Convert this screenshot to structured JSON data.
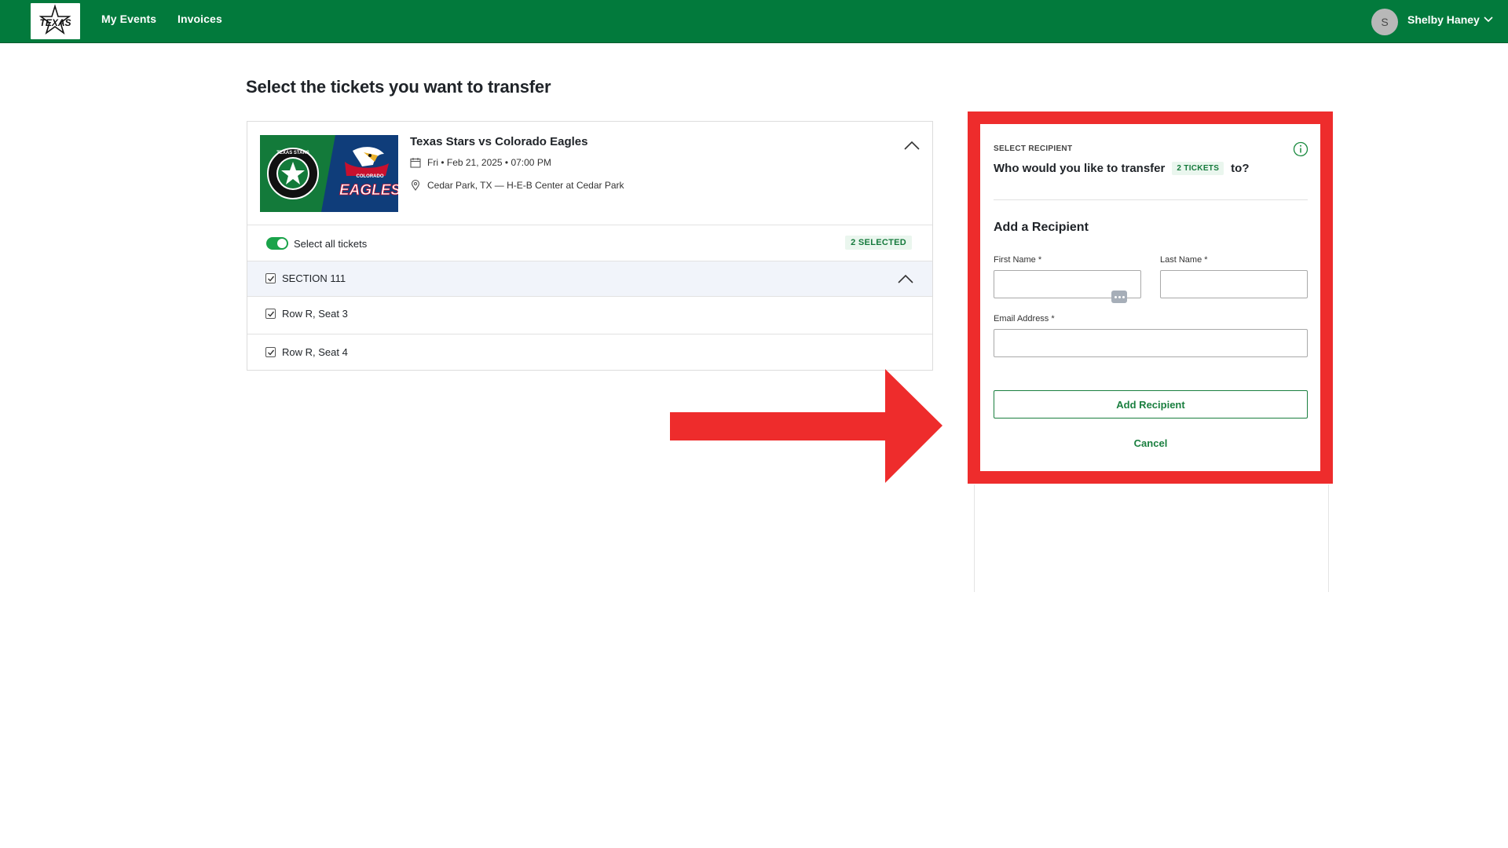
{
  "nav": {
    "logo_text": "TEXAS",
    "links": [
      "My Events",
      "Invoices"
    ],
    "user": {
      "initial": "S",
      "name": "Shelby Haney"
    }
  },
  "page": {
    "title": "Select the tickets you want to transfer"
  },
  "event": {
    "title": "Texas Stars vs Colorado Eagles",
    "datetime": "Fri • Feb 21, 2025 • 07:00 PM",
    "location": "Cedar Park, TX — H-E-B Center at Cedar Park",
    "home_logo_text": "TEXAS STARS",
    "away_logo_text": "EAGLES",
    "away_logo_subtext": "COLORADO"
  },
  "tickets": {
    "select_all_label": "Select all tickets",
    "selected_badge": "2 SELECTED",
    "section_label": "SECTION 111",
    "seats": [
      "Row R, Seat 3",
      "Row R, Seat 4"
    ]
  },
  "recipient": {
    "kicker": "SELECT RECIPIENT",
    "question_pre": "Who would you like to transfer",
    "tickets_badge": "2 TICKETS",
    "question_post": "to?",
    "add_title": "Add a Recipient",
    "first_name_label": "First Name *",
    "last_name_label": "Last Name *",
    "email_label": "Email Address *",
    "first_name_value": "",
    "last_name_value": "",
    "email_value": "",
    "add_button": "Add Recipient",
    "cancel": "Cancel"
  },
  "colors": {
    "brand_green": "#027a3c",
    "highlight_red": "#ee2c2c",
    "accent_green": "#1a7f3f"
  }
}
